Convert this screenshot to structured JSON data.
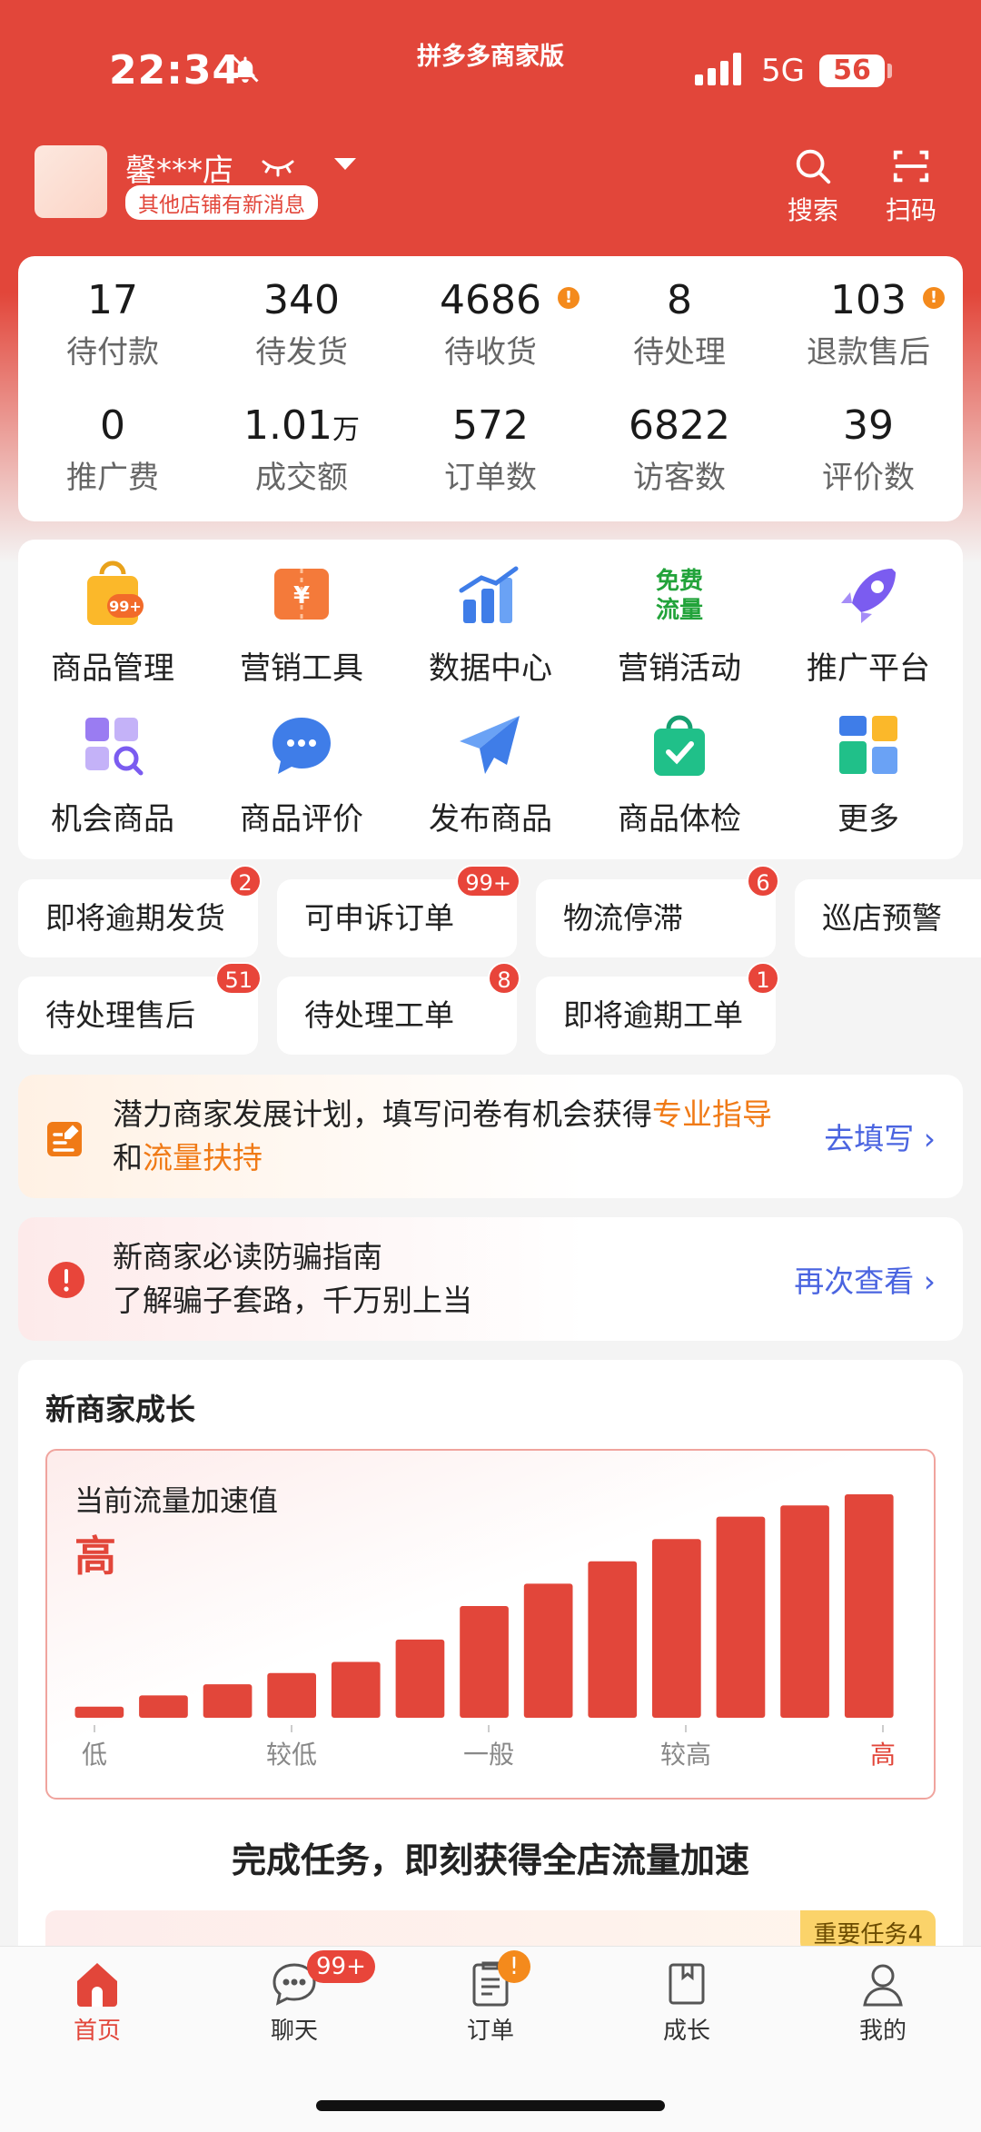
{
  "status_bar": {
    "time": "22:34",
    "app_title": "拼多多商家版",
    "network": "5G",
    "battery": "56"
  },
  "shop": {
    "name": "馨***店",
    "notice": "其他店铺有新消息",
    "search_label": "搜索",
    "scan_label": "扫码"
  },
  "stats": [
    {
      "value": "17",
      "label": "待付款",
      "alert": false
    },
    {
      "value": "340",
      "label": "待发货",
      "alert": false
    },
    {
      "value": "4686",
      "label": "待收货",
      "alert": true
    },
    {
      "value": "8",
      "label": "待处理",
      "alert": false
    },
    {
      "value": "103",
      "label": "退款售后",
      "alert": true
    },
    {
      "value": "0",
      "label": "推广费",
      "alert": false
    },
    {
      "value": "1.01",
      "unit": "万",
      "label": "成交额",
      "alert": false
    },
    {
      "value": "572",
      "label": "订单数",
      "alert": false
    },
    {
      "value": "6822",
      "label": "访客数",
      "alert": false
    },
    {
      "value": "39",
      "label": "评价数",
      "alert": false
    }
  ],
  "alert_mark": "!",
  "grid": [
    {
      "label": "商品管理",
      "icon": "shopping-bag-icon",
      "badge": "99+"
    },
    {
      "label": "营销工具",
      "icon": "coupon-icon"
    },
    {
      "label": "数据中心",
      "icon": "bar-chart-icon"
    },
    {
      "label": "营销活动",
      "icon": "free-traffic-icon",
      "icon_text": [
        "免费",
        "流量"
      ]
    },
    {
      "label": "推广平台",
      "icon": "rocket-icon"
    },
    {
      "label": "机会商品",
      "icon": "search-grid-icon"
    },
    {
      "label": "商品评价",
      "icon": "chat-bubble-icon"
    },
    {
      "label": "发布商品",
      "icon": "paper-plane-icon"
    },
    {
      "label": "商品体检",
      "icon": "check-bag-icon"
    },
    {
      "label": "更多",
      "icon": "more-apps-icon"
    }
  ],
  "chips": [
    {
      "label": "即将逾期发货",
      "badge": "2"
    },
    {
      "label": "可申诉订单",
      "badge": "99+"
    },
    {
      "label": "物流停滞",
      "badge": "6"
    },
    {
      "label": "巡店预警",
      "badge": ""
    },
    {
      "label": "待处理售后",
      "badge": "51"
    },
    {
      "label": "待处理工单",
      "badge": "8"
    },
    {
      "label": "即将逾期工单",
      "badge": "1"
    }
  ],
  "banner_plan": {
    "text_a": "潜力商家发展计划，填写问卷有机会获得",
    "hl_a": "专业指导",
    "text_b": "和",
    "hl_b": "流量扶持",
    "link": "去填写"
  },
  "banner_guide": {
    "line1": "新商家必读防骗指南",
    "line2": "了解骗子套路，千万别上当",
    "link": "再次查看"
  },
  "growth": {
    "title": "新商家成长",
    "chart_label": "当前流量加速值",
    "current_value": "高",
    "task_title": "完成任务，即刻获得全店流量加速",
    "task_tag": "重要任务4"
  },
  "chart_data": {
    "type": "bar",
    "values": [
      1,
      2,
      3,
      4,
      5,
      7,
      10,
      12,
      14,
      16,
      18,
      19,
      20
    ],
    "x_tick_labels": [
      "低",
      "较低",
      "一般",
      "较高",
      "高"
    ],
    "highlight_tick": "高",
    "colors": {
      "bar": "#e2463a",
      "tick": "#888888",
      "highlight": "#e2463a"
    }
  },
  "tabbar": [
    {
      "label": "首页",
      "icon": "home-icon",
      "active": true,
      "badge": ""
    },
    {
      "label": "聊天",
      "icon": "chat-icon",
      "active": false,
      "badge": "99+"
    },
    {
      "label": "订单",
      "icon": "order-icon",
      "active": false,
      "badge": "!"
    },
    {
      "label": "成长",
      "icon": "book-icon",
      "active": false,
      "badge": ""
    },
    {
      "label": "我的",
      "icon": "user-icon",
      "active": false,
      "badge": ""
    }
  ],
  "colors": {
    "brand": "#e2463a",
    "accent_orange": "#f07a16",
    "link_blue": "#4a64e0"
  }
}
